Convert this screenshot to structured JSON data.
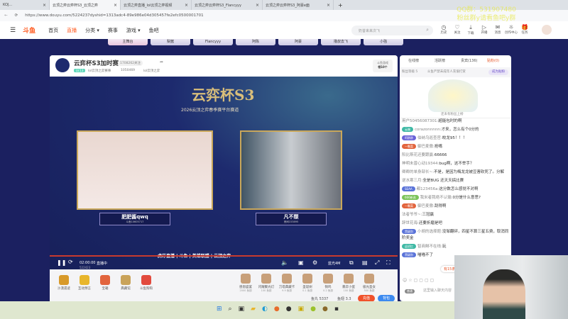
{
  "browser": {
    "tabs": [
      {
        "title": "KOJ..."
      },
      {
        "title": "云顶之弈云弈杯S3_云顶之弈"
      },
      {
        "title": "云顶之弈直播_lol云顶之弈视频"
      },
      {
        "title": "云顶之弈云弈杯S3_Flancyyy"
      },
      {
        "title": "云顶之弈云弈杯S3_阿豪e面"
      }
    ],
    "new_tab": "+",
    "url": "https://www.douyu.com/5224237dyshid=1313adc4-89e986e04d305457fe2efc0500001701"
  },
  "nav": {
    "logo": "斗鱼",
    "items": [
      "首页",
      "直播",
      "分类 ▾",
      "赛事",
      "游戏 ▾",
      "鱼吧"
    ],
    "search_placeholder": "奶昔来来次飞",
    "icons": [
      "历史",
      "关注",
      "下载",
      "开播",
      "消息",
      "创作中心",
      "任务"
    ]
  },
  "watermark": [
    "QQ群：531907480",
    "粉丝群y请看鱼吧y群"
  ],
  "subtabs": [
    "主舞台",
    "梨酱",
    "Flancyyy",
    "阿陈",
    "阿豪",
    "撸叔去飞",
    "小強"
  ],
  "room": {
    "title": "云弈杯S3加时赛",
    "followers": "1708262关注",
    "level": "LV.13",
    "category": "lol云顶之弈赛事",
    "hot": "1050469",
    "tag": "lol云顶之弈",
    "fishball_label": "斗鱼游戏",
    "fishball_sub": "领10个"
  },
  "video": {
    "banner": "云弈杯S3",
    "subtitle": "2026云顶之弈春季赛平台赛道",
    "player1": {
      "name": "肥肥酱qwq",
      "id": "斗鱼10605717"
    },
    "player2": {
      "name": "凡不颓",
      "id": "房间153895"
    },
    "sponsors": "虎牙直播 | 斗鱼 | 英雄联盟 | 云顶之弈",
    "time": "02:00:00",
    "status": "直播中",
    "room_no": "522423",
    "quality": "蓝光4M"
  },
  "gifts_left": [
    "沙漠遗迹",
    "互动预言",
    "宝箱",
    "典藏馆",
    "斗鱼狗钩"
  ],
  "gifts_right": [
    {
      "name": "感恩盛宴",
      "price": "2000 鱼翅"
    },
    {
      "name": "闪耀聚光灯",
      "price": "100 鱼翅"
    },
    {
      "name": "刀塔典藏卡",
      "price": "9.9 鱼翅"
    },
    {
      "name": "圣诞树",
      "price": "0.1 鱼翅"
    },
    {
      "name": "铜鸣",
      "price": "0.2 鱼翅"
    },
    {
      "name": "暴弈小蛋",
      "price": "100 鱼翅"
    },
    {
      "name": "极光圣女",
      "price": "500 鱼翅"
    }
  ],
  "wallet": {
    "yuwan": "鱼丸 5337",
    "yuchi": "鱼翅 3.3",
    "recharge": "充值",
    "backpack": "背包"
  },
  "chat": {
    "tabs": [
      "在线榜",
      "活跃榜",
      "贵宾(136)",
      "贴粉(0)"
    ],
    "fan_level": "粉丝等级 5",
    "notice": "斗鱼严禁未成年人充值打赏",
    "become_fan": "成为贴粉",
    "empty_text": "还未有粉丝上榜",
    "messages": [
      {
        "badge": "",
        "color": "",
        "user": "用户50456087301:",
        "text": "超能包时的啊"
      },
      {
        "badge": "云端",
        "color": "#3fb9a5",
        "user": "corazonnnnn:",
        "text": "才来，怎么有个0分的"
      },
      {
        "badge": "阿欧欧",
        "color": "#6a62d8",
        "user": "伯纳乌巡查官:",
        "text": "皎龙95！！！"
      },
      {
        "badge": "一颗菜",
        "color": "#e2643d",
        "user": "御巴麦傲:",
        "text": "抢嘴"
      },
      {
        "badge": "",
        "color": "",
        "user": "阳比斯花还要跟赢:",
        "text": "66666"
      },
      {
        "badge": "",
        "color": "",
        "user": "神明未曾心动19344:",
        "text": "bug啊，这不举手？"
      },
      {
        "badge": "",
        "color": "",
        "user": "卿卿的单身部长~:",
        "text": "不是，是因为梅龙龙被豆害砍死了。分解"
      },
      {
        "badge": "",
        "color": "",
        "user": "逆水寒三月:",
        "text": "全是BUG 还天天搞比赛"
      },
      {
        "badge": "SEAA",
        "color": "#5a73d8",
        "user": "都123456a:",
        "text": "这分数怎么感觉不对啊"
      },
      {
        "badge": "666新选",
        "color": "#7cc35a",
        "user": "我米者我绝不认输:",
        "text": "0分是什么意思?"
      },
      {
        "badge": "一颗菜",
        "color": "#e2643d",
        "user": "御巴麦傲:",
        "text": "刮得啊"
      },
      {
        "badge": "",
        "color": "",
        "user": "法者爷爷~:",
        "text": "三冠赢"
      },
      {
        "badge": "",
        "color": "",
        "user": "辞世花海:",
        "text": "还要折磨是吧"
      },
      {
        "badge": "黑级别",
        "color": "#5a73d8",
        "user": "小胡的选择题:",
        "text": "没邹翻砰，四星不算三星五费，取消同阶奖金"
      },
      {
        "badge": "返初忆",
        "color": "#3fb9a5",
        "user": "智商鲱不在线:",
        "text": "玩"
      },
      {
        "badge": "黑级别",
        "color": "#5a73d8",
        "user": "",
        "text": "喵喵不了"
      }
    ],
    "new_msgs": "有15条新消息",
    "input_placeholder": "这里输入聊天内容",
    "input_badge": "普通"
  }
}
